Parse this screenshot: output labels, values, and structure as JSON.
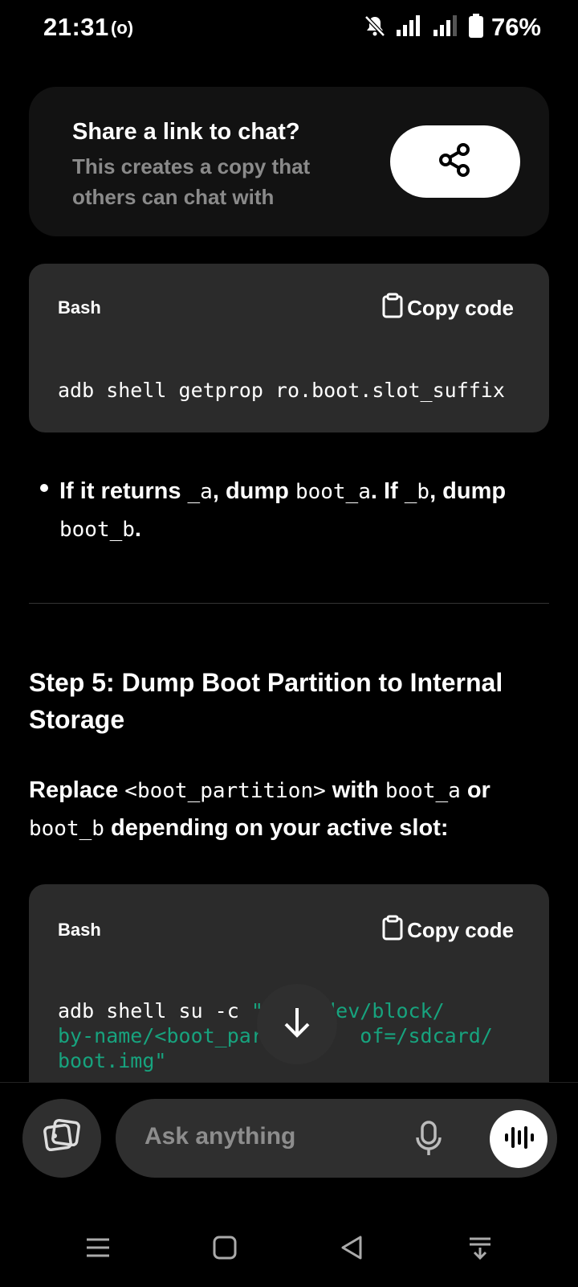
{
  "status_bar": {
    "time": "21:31",
    "hotspot_glyph": "(o)",
    "battery": "76%",
    "icons": [
      "bell-off-icon",
      "signal-icon",
      "signal-weak-icon",
      "battery-icon"
    ]
  },
  "share_card": {
    "title": "Share a link to chat?",
    "subtitle": "This creates a copy that others can chat with",
    "button_icon": "share-icon"
  },
  "code_block_1": {
    "language": "Bash",
    "copy_label": "Copy code",
    "code": "adb shell getprop ro.boot.slot_suffix"
  },
  "bullet": {
    "t1": "If it returns ",
    "c1": "_a",
    "t2": ", dump ",
    "c2": "boot_a",
    "t3": ". If ",
    "c3": "_b",
    "t4": ", dump",
    "c4": "boot_b",
    "t5": "."
  },
  "step_heading": "Step 5: Dump Boot Partition to Internal Storage",
  "paragraph": {
    "t1": "Replace ",
    "c1": "<boot_partition>",
    "t2": " with ",
    "c2": "boot_a",
    "t3": " or",
    "c3": "boot_b",
    "t4": " depending on your active slot:"
  },
  "code_block_2": {
    "language": "Bash",
    "copy_label": "Copy code",
    "line1_plain": "adb shell su -c ",
    "line1_str": "\"d    dev/block/",
    "line2_str": "by-name/<boot_part       of=/sdcard/",
    "line3_str": "boot.img\""
  },
  "composer": {
    "placeholder": "Ask anything",
    "attach_icon": "image-attach-icon",
    "mic_icon": "mic-icon",
    "voice_icon": "voice-mode-icon"
  },
  "nav_bar": {
    "items": [
      "menu-icon",
      "home-icon",
      "back-icon",
      "notifications-icon"
    ]
  },
  "colors": {
    "background": "#000000",
    "card": "#121212",
    "code_bg": "#2b2b2b",
    "code_string": "#17a37e",
    "muted_text": "#8a8a8a"
  }
}
